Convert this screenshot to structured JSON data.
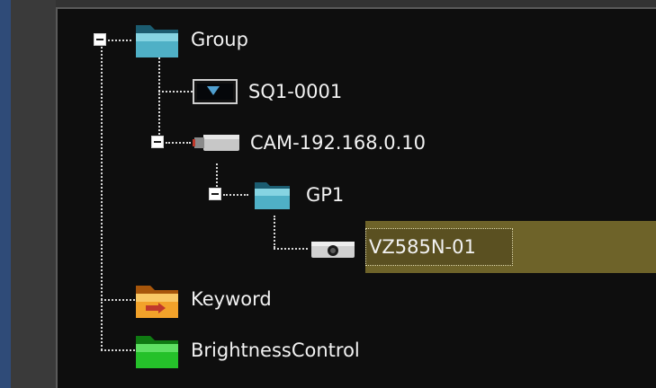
{
  "tree": {
    "nodes": [
      {
        "id": "group",
        "label": "Group",
        "expanded": true,
        "icon": "folder-teal-icon"
      },
      {
        "id": "sq1",
        "label": "SQ1-0001",
        "icon": "monitor-device-icon"
      },
      {
        "id": "cam",
        "label": "CAM-192.168.0.10",
        "expanded": true,
        "icon": "camera-icon"
      },
      {
        "id": "gp1",
        "label": "GP1",
        "expanded": true,
        "icon": "folder-teal-icon"
      },
      {
        "id": "vz585",
        "label": "VZ585N-01",
        "selected": true,
        "icon": "document-camera-icon"
      },
      {
        "id": "keyword",
        "label": "Keyword",
        "icon": "folder-orange-icon"
      },
      {
        "id": "brightness",
        "label": "BrightnessControl",
        "icon": "folder-green-icon"
      }
    ]
  },
  "colors": {
    "panel_bg": "#0e0e0e",
    "selection": "#6e6329",
    "text": "#f2f2f2",
    "accent": "#2f4b78"
  }
}
